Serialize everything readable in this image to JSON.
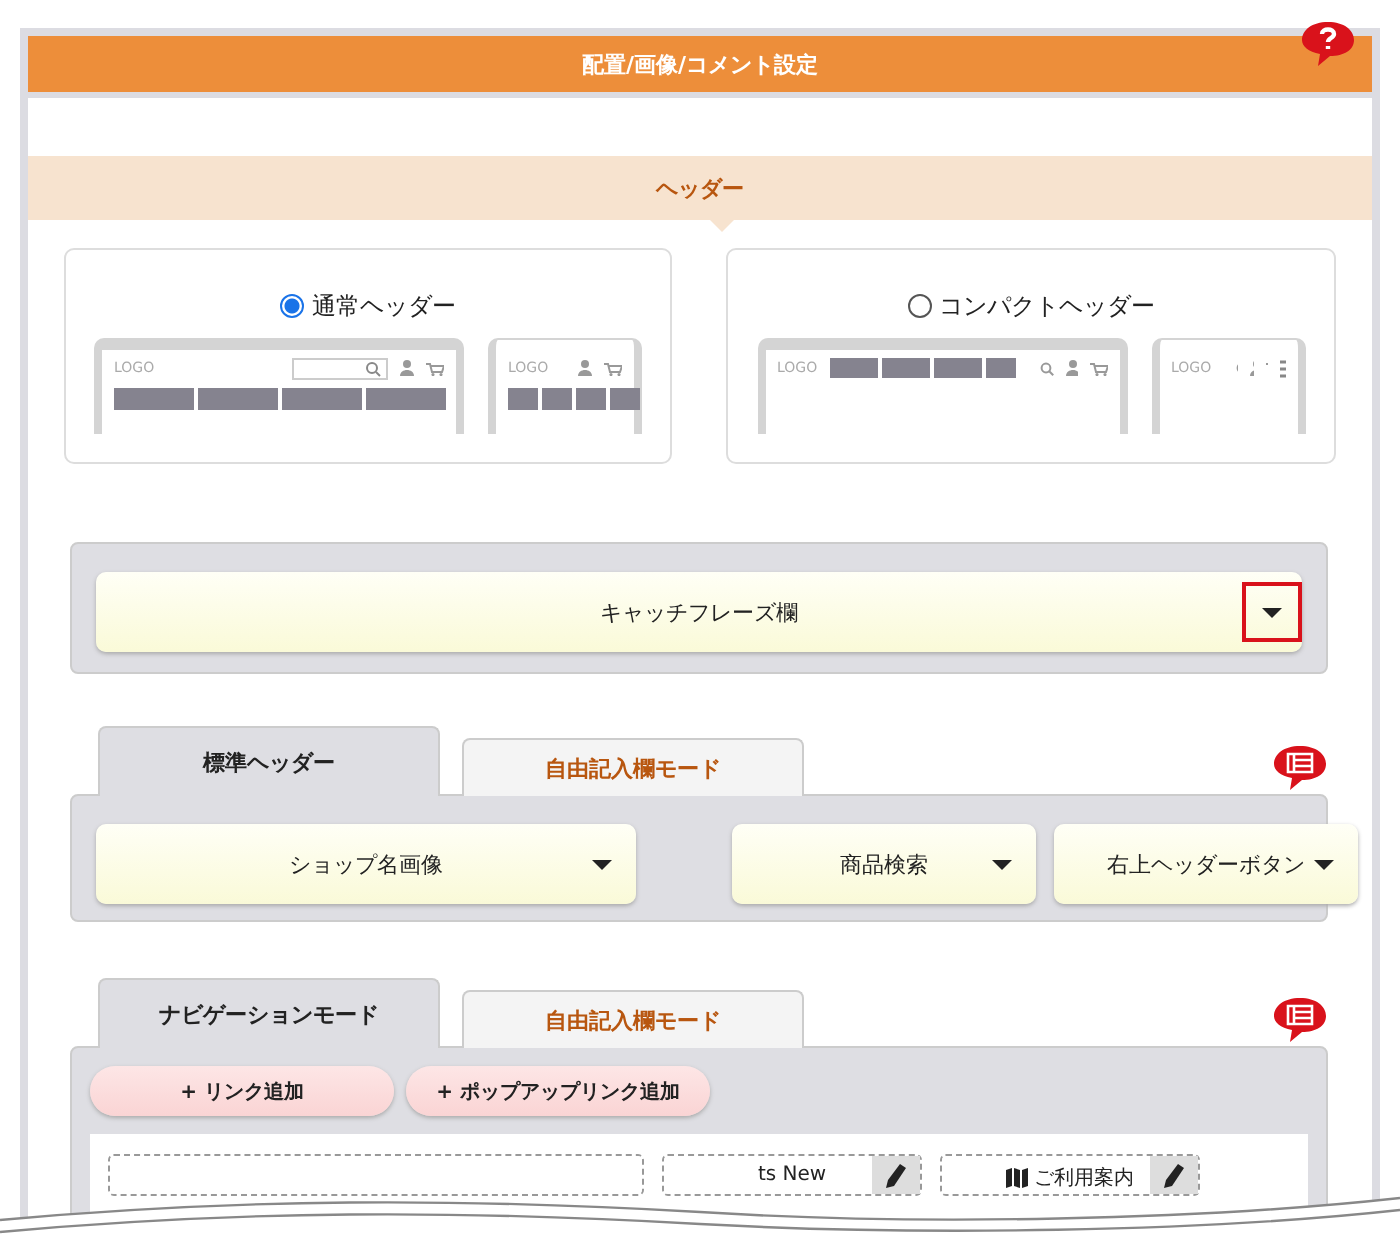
{
  "title": "配置/画像/コメント設定",
  "section": "ヘッダー",
  "header_options": [
    {
      "label": "通常ヘッダー",
      "selected": true,
      "previews": [
        {
          "kind": "desktop_search",
          "logo": "LOGO"
        },
        {
          "kind": "mobile_grid",
          "logo": "LOGO"
        }
      ]
    },
    {
      "label": "コンパクトヘッダー",
      "selected": false,
      "previews": [
        {
          "kind": "desktop_compact",
          "logo": "LOGO"
        },
        {
          "kind": "mobile_menu",
          "logo": "LOGO"
        }
      ]
    }
  ],
  "catchphrase": {
    "label": "キャッチフレーズ欄",
    "highlighted": true
  },
  "header_panel": {
    "tabs": [
      {
        "label": "標準ヘッダー",
        "selected": true
      },
      {
        "label": "自由記入欄モード",
        "selected": false
      }
    ],
    "selects": [
      {
        "label": "ショップ名画像"
      },
      {
        "label": "商品検索"
      },
      {
        "label": "右上ヘッダーボタン"
      }
    ]
  },
  "nav_panel": {
    "tabs": [
      {
        "label": "ナビゲーションモード",
        "selected": true
      },
      {
        "label": "自由記入欄モード",
        "selected": false
      }
    ],
    "buttons": [
      "+ リンク追加",
      "+ ポップアップリンク追加"
    ],
    "items": [
      {
        "kind": "hidden"
      },
      {
        "kind": "plain",
        "label": "ts New"
      },
      {
        "kind": "icon",
        "label": "ご利用案内"
      }
    ]
  }
}
